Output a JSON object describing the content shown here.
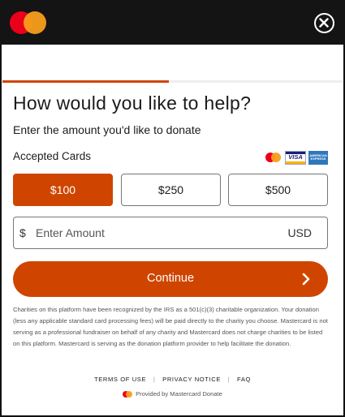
{
  "header": {
    "logo_icon": "mastercard-logo",
    "close_icon": "close-circle-icon"
  },
  "progress": {
    "fraction": 0.49,
    "color": "#cf4500"
  },
  "main": {
    "title": "How would you like to help?",
    "subtitle": "Enter the amount you'd like to donate",
    "accepted_cards_label": "Accepted Cards",
    "card_logos": {
      "visa_text": "VISA",
      "amex_text": "AMERICAN EXPRESS"
    },
    "amounts": [
      {
        "label": "$100",
        "selected": true
      },
      {
        "label": "$250",
        "selected": false
      },
      {
        "label": "$500",
        "selected": false
      }
    ],
    "amount_input": {
      "currency_symbol": "$",
      "placeholder": "Enter Amount",
      "value": "",
      "currency_code": "USD"
    },
    "continue_label": "Continue",
    "disclaimer": "Charities on this platform have been recognized by the IRS as a 501(c)(3) charitable organization. Your donation (less any applicable standard card processing fees) will be paid directly to the charity you choose. Mastercard is not serving as a professional fundraiser on behalf of any charity and Mastercard does not charge charities to be listed on this platform. Mastercard is serving as the donation platform provider to help facilitate the donation."
  },
  "footer": {
    "links": [
      "TERMS OF USE",
      "PRIVACY NOTICE",
      "FAQ"
    ],
    "separator": "|",
    "provided_by": "Provided by Mastercard Donate"
  },
  "colors": {
    "accent": "#cf4500",
    "header_bg": "#141414",
    "mc_red": "#eb001b",
    "mc_yellow": "#f79e1b"
  }
}
